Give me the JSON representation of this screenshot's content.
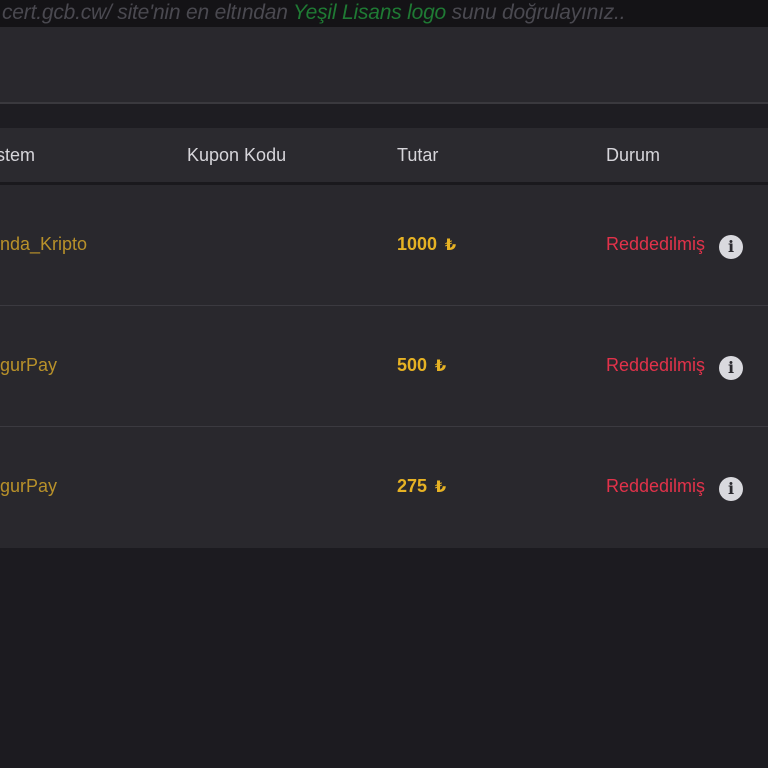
{
  "notice": {
    "prefix": "cert.gcb.cw/ site'nin en eltından ",
    "link": "Yeşil Lisans logo",
    "suffix": " sunu doğrulayınız.."
  },
  "table": {
    "headers": {
      "system": "stem",
      "coupon": "Kupon Kodu",
      "amount": "Tutar",
      "status": "Durum"
    },
    "currency_symbol": "₺",
    "rows": [
      {
        "system": "inda_Kripto",
        "coupon": "",
        "amount": "1000",
        "status": "Reddedilmiş"
      },
      {
        "system": "lgurPay",
        "coupon": "",
        "amount": "500",
        "status": "Reddedilmiş"
      },
      {
        "system": "lgurPay",
        "coupon": "",
        "amount": "275",
        "status": "Reddedilmiş"
      }
    ]
  },
  "icons": {
    "info": "info-circle-icon",
    "currency": "turkish-lira-icon"
  },
  "colors": {
    "link_green": "#1f7a34",
    "system_gold": "#b8912a",
    "amount_gold": "#e6b224",
    "status_red": "#e2324a"
  }
}
